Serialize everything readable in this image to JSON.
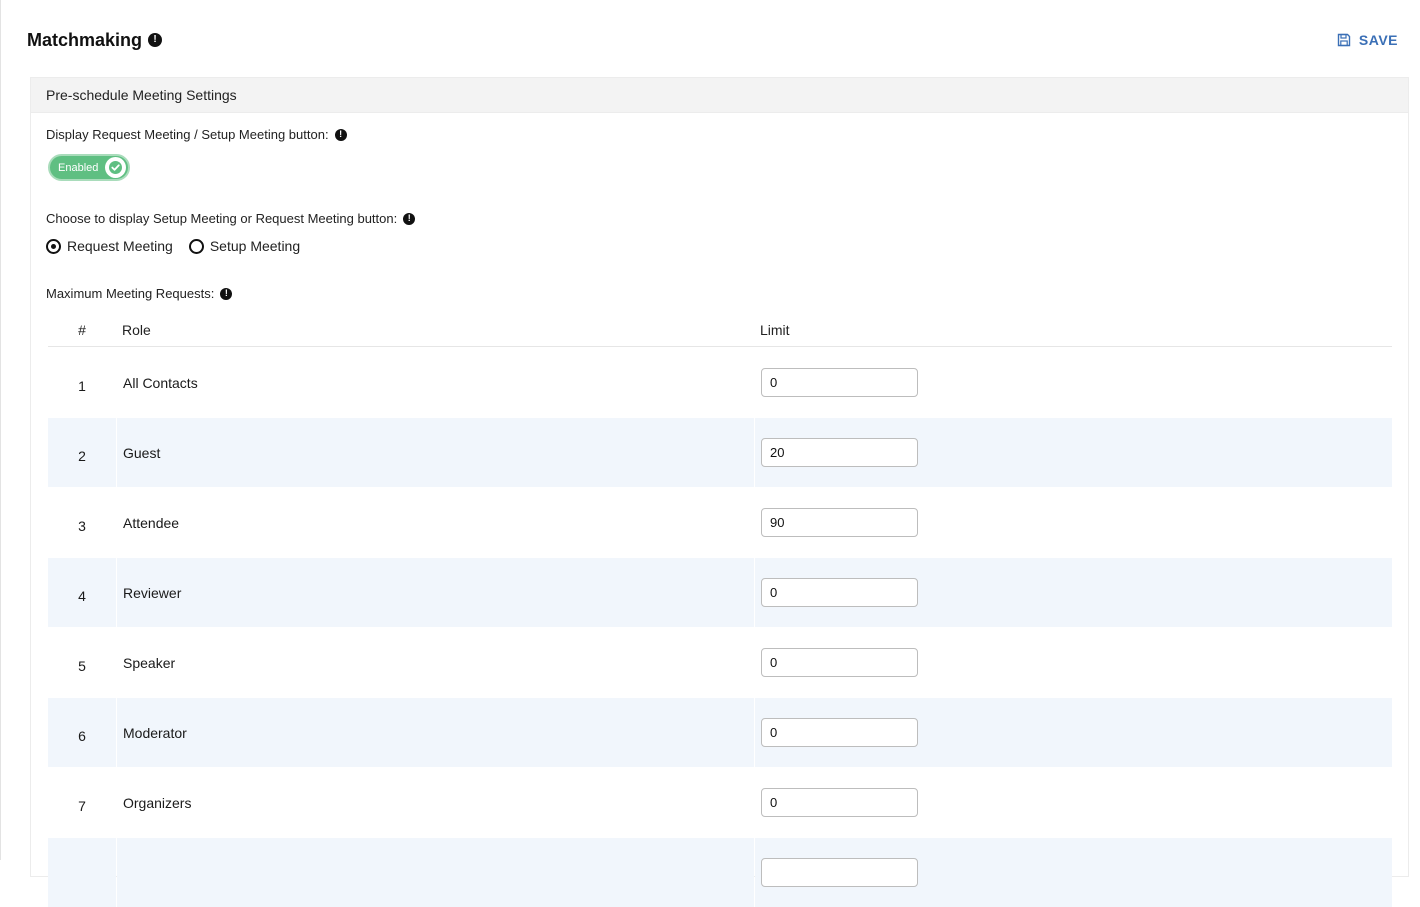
{
  "header": {
    "title": "Matchmaking",
    "save_label": "SAVE"
  },
  "panel": {
    "title": "Pre-schedule Meeting Settings",
    "display_button_label": "Display Request Meeting / Setup Meeting button:",
    "toggle_label": "Enabled",
    "toggle_on": true,
    "choose_label": "Choose to display Setup Meeting or Request Meeting button:",
    "radio_options": [
      "Request Meeting",
      "Setup Meeting"
    ],
    "radio_selected": "Request Meeting",
    "max_requests_label": "Maximum Meeting Requests:"
  },
  "table": {
    "headers": {
      "num": "#",
      "role": "Role",
      "limit": "Limit"
    },
    "rows": [
      {
        "num": "1",
        "role": "All Contacts",
        "limit": "0"
      },
      {
        "num": "2",
        "role": "Guest",
        "limit": "20"
      },
      {
        "num": "3",
        "role": "Attendee",
        "limit": "90"
      },
      {
        "num": "4",
        "role": "Reviewer",
        "limit": "0"
      },
      {
        "num": "5",
        "role": "Speaker",
        "limit": "0"
      },
      {
        "num": "6",
        "role": "Moderator",
        "limit": "0"
      },
      {
        "num": "7",
        "role": "Organizers",
        "limit": "0"
      },
      {
        "num": "",
        "role": "",
        "limit": ""
      }
    ]
  },
  "colors": {
    "accent": "#3a6fb6",
    "toggle_on": "#5fbf82",
    "row_alt": "#f1f6fc"
  },
  "icons": {
    "info": "info-icon",
    "save": "floppy-disk-icon",
    "check": "check-icon"
  }
}
